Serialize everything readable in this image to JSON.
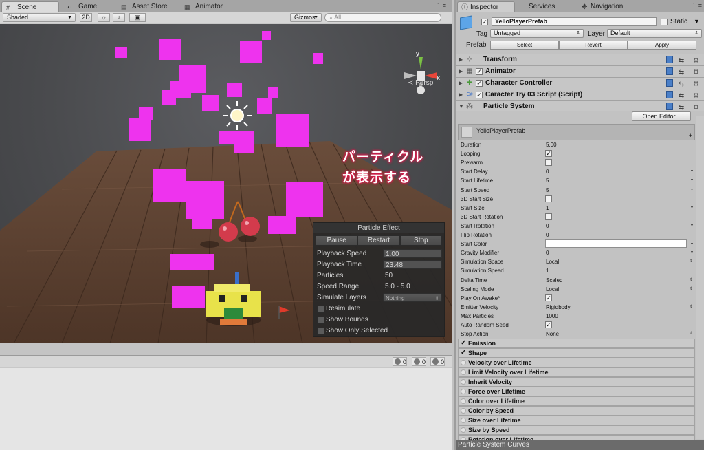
{
  "scene_tabs": [
    {
      "label": "Scene",
      "icon": "scene-icon"
    },
    {
      "label": "Game",
      "icon": "game-icon"
    },
    {
      "label": "Asset Store",
      "icon": "asset-store-icon"
    },
    {
      "label": "Animator",
      "icon": "animator-icon"
    }
  ],
  "scene_toolbar": {
    "shading": "Shaded",
    "mode_2d": "2D",
    "gizmos": "Gizmos",
    "search_placeholder": "All"
  },
  "scene": {
    "persp_label": "Persp",
    "gizmo_y": "y",
    "gizmo_x": "x",
    "annotation_line1": "パーティクル",
    "annotation_line2": "が表示する"
  },
  "particle_effect": {
    "title": "Particle Effect",
    "buttons": [
      "Pause",
      "Restart",
      "Stop"
    ],
    "playback_speed_label": "Playback Speed",
    "playback_speed": "1.00",
    "playback_time_label": "Playback Time",
    "playback_time": "23.48",
    "particles_label": "Particles",
    "particles": "50",
    "speed_range_label": "Speed Range",
    "speed_range": "5.0 - 5.0",
    "simulate_layers_label": "Simulate Layers",
    "simulate_layers": "Nothing",
    "resimulate": "Resimulate",
    "show_bounds": "Show Bounds",
    "show_only_selected": "Show Only Selected"
  },
  "console": {
    "errors": "0",
    "warnings": "0",
    "logs": "0"
  },
  "inspector_tabs": [
    {
      "label": "Inspector",
      "icon": "info-icon"
    },
    {
      "label": "Services",
      "icon": "cloud-icon"
    },
    {
      "label": "Navigation",
      "icon": "navigation-icon"
    }
  ],
  "object": {
    "name": "YelloPlayerPrefab",
    "static_label": "Static",
    "tag_label": "Tag",
    "tag": "Untagged",
    "layer_label": "Layer",
    "layer": "Default",
    "prefab_label": "Prefab",
    "prefab_select": "Select",
    "prefab_revert": "Revert",
    "prefab_apply": "Apply"
  },
  "components": [
    {
      "name": "Transform",
      "has_check": false,
      "icon": "transform-icon"
    },
    {
      "name": "Animator",
      "has_check": true,
      "icon": "animator-icon"
    },
    {
      "name": "Character Controller",
      "has_check": true,
      "icon": "character-controller-icon"
    },
    {
      "name": "Caracter Try 03 Script (Script)",
      "has_check": true,
      "icon": "script-icon"
    },
    {
      "name": "Particle System",
      "has_check": false,
      "icon": "particle-system-icon"
    }
  ],
  "particle_system": {
    "open_editor": "Open Editor...",
    "header_name": "YelloPlayerPrefab",
    "header_plus": "+",
    "rows": [
      {
        "label": "Duration",
        "value": "5.00",
        "kind": "text"
      },
      {
        "label": "Looping",
        "value": "✓",
        "kind": "check"
      },
      {
        "label": "Prewarm",
        "value": "",
        "kind": "check"
      },
      {
        "label": "Start Delay",
        "value": "0",
        "kind": "num"
      },
      {
        "label": "Start Lifetime",
        "value": "5",
        "kind": "num"
      },
      {
        "label": "Start Speed",
        "value": "5",
        "kind": "num"
      },
      {
        "label": "3D Start Size",
        "value": "",
        "kind": "check"
      },
      {
        "label": "Start Size",
        "value": "1",
        "kind": "num"
      },
      {
        "label": "3D Start Rotation",
        "value": "",
        "kind": "check"
      },
      {
        "label": "Start Rotation",
        "value": "0",
        "kind": "num"
      },
      {
        "label": "Flip Rotation",
        "value": "0",
        "kind": "text"
      },
      {
        "label": "Start Color",
        "value": "",
        "kind": "color"
      },
      {
        "label": "Gravity Modifier",
        "value": "0",
        "kind": "num"
      },
      {
        "label": "Simulation Space",
        "value": "Local",
        "kind": "dropdown"
      },
      {
        "label": "Simulation Speed",
        "value": "1",
        "kind": "text"
      },
      {
        "label": "Delta Time",
        "value": "Scaled",
        "kind": "dropdown"
      },
      {
        "label": "Scaling Mode",
        "value": "Local",
        "kind": "dropdown"
      },
      {
        "label": "Play On Awake*",
        "value": "✓",
        "kind": "check"
      },
      {
        "label": "Emitter Velocity",
        "value": "Rigidbody",
        "kind": "dropdown"
      },
      {
        "label": "Max Particles",
        "value": "1000",
        "kind": "text"
      },
      {
        "label": "Auto Random Seed",
        "value": "✓",
        "kind": "check"
      },
      {
        "label": "Stop Action",
        "value": "None",
        "kind": "dropdown"
      }
    ],
    "modules": [
      {
        "label": "Emission",
        "checked": true
      },
      {
        "label": "Shape",
        "checked": true
      },
      {
        "label": "Velocity over Lifetime",
        "checked": false
      },
      {
        "label": "Limit Velocity over Lifetime",
        "checked": false
      },
      {
        "label": "Inherit Velocity",
        "checked": false
      },
      {
        "label": "Force over Lifetime",
        "checked": false
      },
      {
        "label": "Color over Lifetime",
        "checked": false
      },
      {
        "label": "Color by Speed",
        "checked": false
      },
      {
        "label": "Size over Lifetime",
        "checked": false
      },
      {
        "label": "Size by Speed",
        "checked": false
      },
      {
        "label": "Rotation over Lifetime",
        "checked": false
      }
    ]
  },
  "curves_label": "Particle System Curves",
  "colors": {
    "particle": "#ee33ee",
    "annotation_outline": "#e0184b",
    "scene_bg": "#4a4b4e",
    "floor_wood": "#5e4434"
  }
}
